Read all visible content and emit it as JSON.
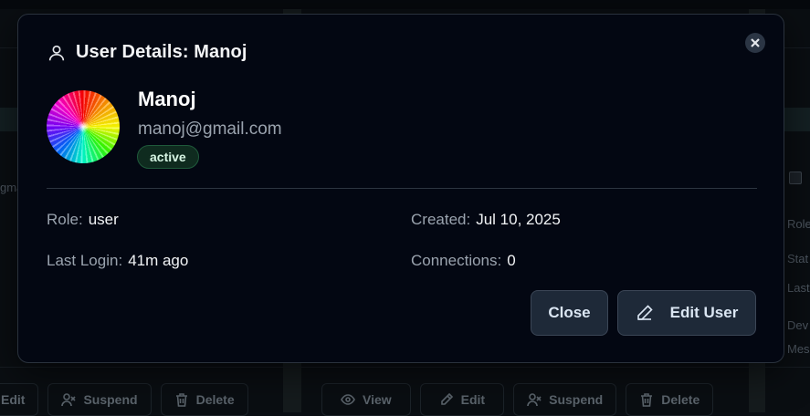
{
  "background": {
    "left_column_text": [
      "gma"
    ],
    "right_column_labels": [
      "Role",
      "Stat",
      "Last",
      "Dev",
      "Mes"
    ],
    "actions_left": [
      {
        "label": "Edit",
        "icon": "pencil-icon"
      },
      {
        "label": "Suspend",
        "icon": "user-x-icon"
      },
      {
        "label": "Delete",
        "icon": "trash-icon"
      }
    ],
    "actions_middle": [
      {
        "label": "View",
        "icon": "eye-icon"
      },
      {
        "label": "Edit",
        "icon": "pencil-icon"
      },
      {
        "label": "Suspend",
        "icon": "user-x-icon"
      },
      {
        "label": "Delete",
        "icon": "trash-icon"
      }
    ]
  },
  "modal": {
    "title": "User Details: Manoj",
    "header_icon": "user-icon",
    "close_icon": "close-icon",
    "user": {
      "name": "Manoj",
      "email": "manoj@gmail.com",
      "status": "active"
    },
    "fields": {
      "role_label": "Role:",
      "role_value": "user",
      "created_label": "Created:",
      "created_value": "Jul 10, 2025",
      "last_login_label": "Last Login:",
      "last_login_value": "41m ago",
      "connections_label": "Connections:",
      "connections_value": "0"
    },
    "buttons": {
      "close_label": "Close",
      "edit_label": "Edit User",
      "edit_icon": "pencil-icon"
    }
  },
  "colors": {
    "modal_bg": "#030712",
    "button_bg": "#1e2938",
    "status_badge_bg": "#0f2b1f",
    "status_badge_border": "#1f5a3b"
  }
}
